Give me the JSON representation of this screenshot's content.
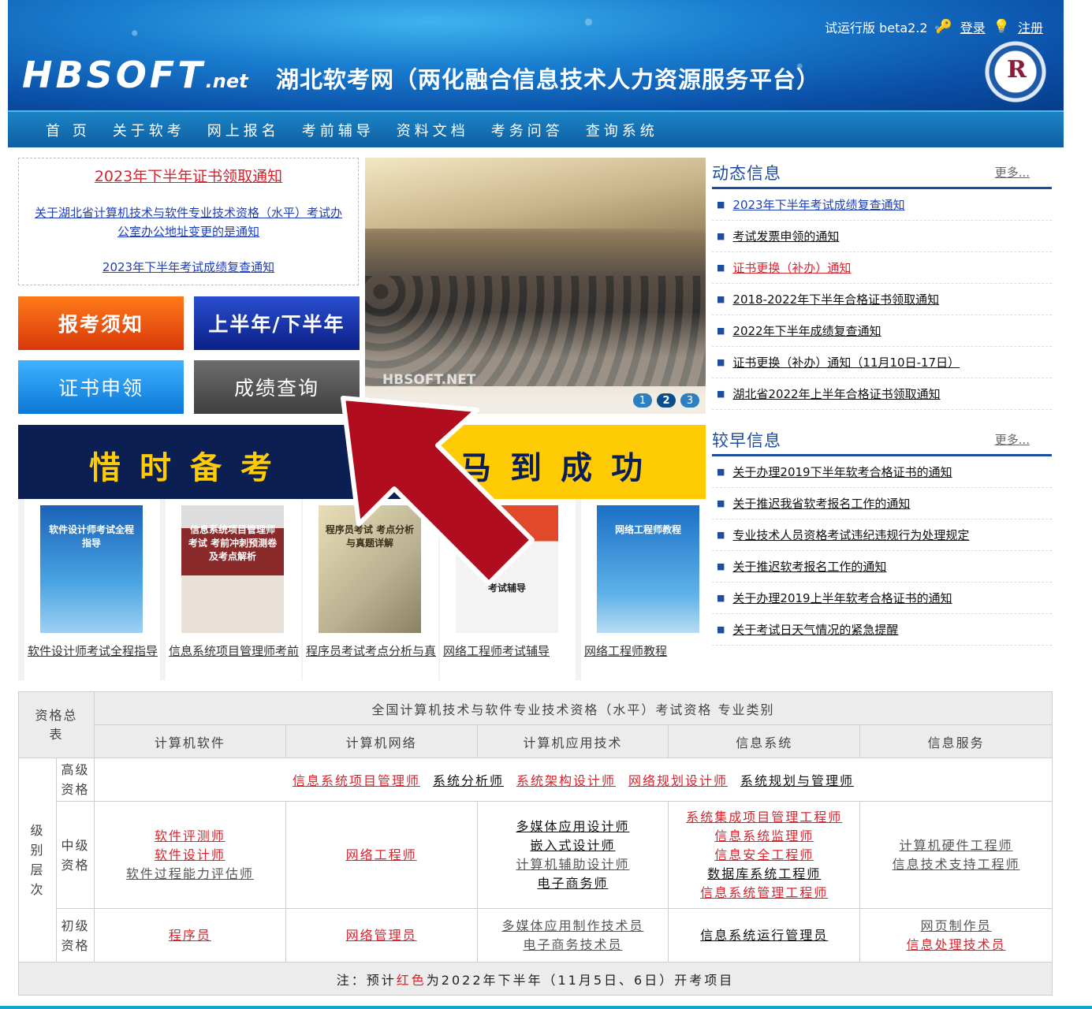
{
  "header": {
    "logo_main": "HBSOFT",
    "logo_suffix": ".net",
    "site_title": "湖北软考网（两化融合信息技术人力资源服务平台）",
    "version": "试运行版 beta2.2",
    "login": "登录",
    "register": "注册"
  },
  "nav": [
    "首 页",
    "关于软考",
    "网上报名",
    "考前辅导",
    "资料文档",
    "考务问答",
    "查询系统"
  ],
  "notice": {
    "n1": "2023年下半年证书领取通知",
    "n2": "关于湖北省计算机技术与软件专业技术资格（水平）考试办公室办公地址变更的是通知",
    "n3": "2023年下半年考试成绩复查通知"
  },
  "quick_buttons": {
    "baokao": "报考须知",
    "banian": "上半年/下半年",
    "zhengshu": "证书申领",
    "chengji": "成绩查询"
  },
  "slider": {
    "watermark": "HBSOFT.NET",
    "pages": [
      "1",
      "2",
      "3"
    ],
    "active": "2"
  },
  "banner": {
    "left": "惜时备考",
    "right": "马到成功"
  },
  "books": [
    {
      "title": "软件设计师考试全程指导",
      "cover_text": "软件设计师考试全程指导"
    },
    {
      "title": "信息系统项目管理师考前冲刺预测卷",
      "cover_text": "信息系统项目管理师考试 考前冲刺预测卷及考点解析"
    },
    {
      "title": "程序员考试考点分析与真题详解",
      "cover_text": "程序员考试 考点分析与真题详解"
    },
    {
      "title": "网络工程师考试辅导",
      "cover_text": "考试辅导"
    },
    {
      "title": "网络工程师教程",
      "cover_text": "网络工程师教程"
    }
  ],
  "news_dynamic": {
    "title": "动态信息",
    "more": "更多...",
    "items": [
      {
        "text": "2023年下半年考试成绩复查通知",
        "style": "blue"
      },
      {
        "text": "考试发票申领的通知",
        "style": "black"
      },
      {
        "text": "证书更换（补办）通知",
        "style": "red"
      },
      {
        "text": "2018-2022年下半年合格证书领取通知",
        "style": "black"
      },
      {
        "text": "2022年下半年成绩复查通知",
        "style": "black"
      },
      {
        "text": "证书更换（补办）通知（11月10日-17日）",
        "style": "black"
      },
      {
        "text": "湖北省2022年上半年合格证书领取通知",
        "style": "black"
      }
    ]
  },
  "news_early": {
    "title": "较早信息",
    "more": "更多...",
    "items": [
      "关于办理2019下半年软考合格证书的通知",
      "关于推迟我省软考报名工作的通知",
      "专业技术人员资格考试违纪违规行为处理规定",
      "关于推迟软考报名工作的通知",
      "关于办理2019上半年软考合格证书的通知",
      "关于考试日天气情况的紧急提醒"
    ]
  },
  "table": {
    "corner": "资格总表",
    "header": "全国计算机技术与软件专业技术资格（水平）考试资格 专业类别",
    "categories": [
      "计算机软件",
      "计算机网络",
      "计算机应用技术",
      "信息系统",
      "信息服务"
    ],
    "level_label": "级别层次",
    "senior": {
      "label": "高级资格",
      "items": [
        {
          "text": "信息系统项目管理师",
          "red": true
        },
        {
          "text": "系统分析师",
          "red": false
        },
        {
          "text": "系统架构设计师",
          "red": true
        },
        {
          "text": "网络规划设计师",
          "red": true
        },
        {
          "text": "系统规划与管理师",
          "red": false
        }
      ]
    },
    "middle": {
      "label": "中级资格",
      "cols": [
        [
          {
            "text": "软件评测师",
            "c": "red"
          },
          {
            "text": "软件设计师",
            "c": "red"
          },
          {
            "text": "软件过程能力评估师",
            "c": "gry"
          }
        ],
        [
          {
            "text": "网络工程师",
            "c": "red"
          }
        ],
        [
          {
            "text": "多媒体应用设计师",
            "c": "blk"
          },
          {
            "text": "嵌入式设计师",
            "c": "blk"
          },
          {
            "text": "计算机辅助设计师",
            "c": "gry"
          },
          {
            "text": "电子商务师",
            "c": "blk"
          }
        ],
        [
          {
            "text": "系统集成项目管理工程师",
            "c": "red"
          },
          {
            "text": "信息系统监理师",
            "c": "red"
          },
          {
            "text": "信息安全工程师",
            "c": "red"
          },
          {
            "text": "数据库系统工程师",
            "c": "blk"
          },
          {
            "text": "信息系统管理工程师",
            "c": "red"
          }
        ],
        [
          {
            "text": "计算机硬件工程师",
            "c": "gry"
          },
          {
            "text": "信息技术支持工程师",
            "c": "gry"
          }
        ]
      ]
    },
    "junior": {
      "label": "初级资格",
      "cols": [
        [
          {
            "text": "程序员",
            "c": "red"
          }
        ],
        [
          {
            "text": "网络管理员",
            "c": "red"
          }
        ],
        [
          {
            "text": "多媒体应用制作技术员",
            "c": "gry"
          },
          {
            "text": "电子商务技术员",
            "c": "gry"
          }
        ],
        [
          {
            "text": "信息系统运行管理员",
            "c": "blk"
          }
        ],
        [
          {
            "text": "网页制作员",
            "c": "gry"
          },
          {
            "text": "信息处理技术员",
            "c": "red"
          }
        ]
      ]
    },
    "note_prefix": "注：预计",
    "note_red": "红色",
    "note_suffix": "为2022年下半年（11月5日、6日）开考项目"
  },
  "colors": {
    "nav_bg": "#0e5fa0",
    "accent_red": "#d9232d",
    "link_blue": "#1f3fb8",
    "arrow": "#b00d1e"
  }
}
